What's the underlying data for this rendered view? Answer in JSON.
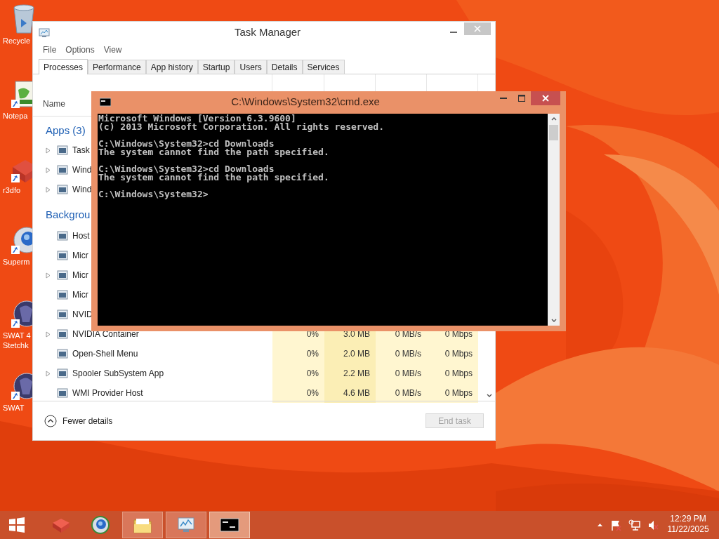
{
  "desktop_icons": [
    {
      "label_lines": [
        "Recycle"
      ]
    },
    {
      "label_lines": [
        "Notepa"
      ]
    },
    {
      "label_lines": [
        "r3dfo"
      ]
    },
    {
      "label_lines": [
        "Superm"
      ]
    },
    {
      "label_lines": [
        "SWAT 4",
        "Stetchk"
      ]
    },
    {
      "label_lines": [
        "SWAT"
      ]
    }
  ],
  "task_manager": {
    "title": "Task Manager",
    "menu": [
      "File",
      "Options",
      "View"
    ],
    "tabs": [
      {
        "label": "Processes",
        "selected": true
      },
      {
        "label": "Performance",
        "selected": false
      },
      {
        "label": "App history",
        "selected": false
      },
      {
        "label": "Startup",
        "selected": false
      },
      {
        "label": "Users",
        "selected": false
      },
      {
        "label": "Details",
        "selected": false
      },
      {
        "label": "Services",
        "selected": false
      }
    ],
    "name_header": "Name",
    "rows": [
      {
        "kind": "group",
        "name": "Apps (3)"
      },
      {
        "kind": "process",
        "name": "Task",
        "expandable": true
      },
      {
        "kind": "process",
        "name": "Wind",
        "expandable": true
      },
      {
        "kind": "process",
        "name": "Wind",
        "expandable": true
      },
      {
        "kind": "group",
        "name": "Backgrou"
      },
      {
        "kind": "process",
        "name": "Host",
        "expandable": false
      },
      {
        "kind": "process",
        "name": "Micr",
        "expandable": false
      },
      {
        "kind": "process",
        "name": "Micr",
        "expandable": true
      },
      {
        "kind": "process",
        "name": "Micr",
        "expandable": false
      },
      {
        "kind": "process",
        "name": "NVID",
        "expandable": false
      },
      {
        "kind": "process",
        "name": "NVIDIA Container",
        "expandable": true,
        "cpu": "0%",
        "memory": "3.0 MB",
        "disk": "0 MB/s",
        "network": "0 Mbps"
      },
      {
        "kind": "process",
        "name": "Open-Shell Menu",
        "expandable": false,
        "cpu": "0%",
        "memory": "2.0 MB",
        "disk": "0 MB/s",
        "network": "0 Mbps"
      },
      {
        "kind": "process",
        "name": "Spooler SubSystem App",
        "expandable": true,
        "cpu": "0%",
        "memory": "2.2 MB",
        "disk": "0 MB/s",
        "network": "0 Mbps"
      },
      {
        "kind": "process",
        "name": "WMI Provider Host",
        "expandable": false,
        "cpu": "0%",
        "memory": "4.6 MB",
        "disk": "0 MB/s",
        "network": "0 Mbps"
      }
    ],
    "fewer_details": "Fewer details",
    "end_task": {
      "label": "End task",
      "disabled": true
    }
  },
  "console_window": {
    "title": "C:\\Windows\\System32\\cmd.exe",
    "blocks": [
      [
        "Microsoft Windows [Version 6.3.9600]",
        "(c) 2013 Microsoft Corporation. All rights reserved."
      ],
      [
        "C:\\Windows\\System32>cd Downloads",
        "The system cannot find the path specified."
      ],
      [
        "C:\\Windows\\System32>cd Downloads",
        "The system cannot find the path specified."
      ],
      [
        "C:\\Windows\\System32>"
      ]
    ]
  },
  "taskbar": {
    "buttons": [
      {
        "open": false,
        "active": false
      },
      {
        "open": false,
        "active": false
      },
      {
        "open": true,
        "active": false
      },
      {
        "open": true,
        "active": false
      },
      {
        "open": true,
        "active": true
      }
    ],
    "clock": {
      "time": "12:29 PM",
      "date": "11/22/2025"
    }
  }
}
